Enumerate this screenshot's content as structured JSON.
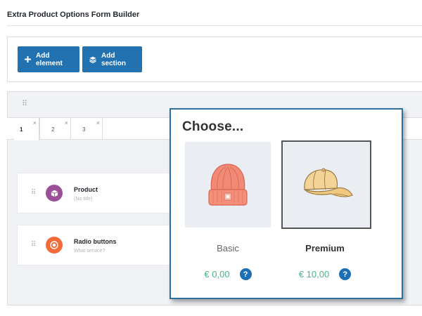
{
  "page": {
    "title": "Extra Product Options Form Builder"
  },
  "toolbar": {
    "add_element_label": "Add element",
    "add_section_label": "Add section",
    "add_element_icon": "plus-icon",
    "add_section_icon": "layers-icon",
    "button_color": "#2271b1"
  },
  "builder": {
    "drag_glyph": "⠿",
    "tabs": [
      {
        "label": "1",
        "active": true,
        "close": "×"
      },
      {
        "label": "2",
        "active": false,
        "close": "×"
      },
      {
        "label": "3",
        "active": false,
        "close": "×"
      }
    ],
    "elements": [
      {
        "name": "Product",
        "subtitle": "(No title)",
        "icon": "cube-icon",
        "color": "#9b4f97"
      },
      {
        "name": "Radio buttons",
        "subtitle": "What service?",
        "icon": "radio-icon",
        "color": "#f26b38"
      }
    ]
  },
  "popup": {
    "title": "Choose...",
    "options": [
      {
        "label": "Basic",
        "price": "€ 0,00",
        "image": "beanie-icon",
        "selected": false,
        "help": "?"
      },
      {
        "label": "Premium",
        "price": "€ 10,00",
        "image": "cap-icon",
        "selected": true,
        "help": "?"
      }
    ],
    "price_color": "#4cb483",
    "help_color": "#1d6fb3"
  }
}
